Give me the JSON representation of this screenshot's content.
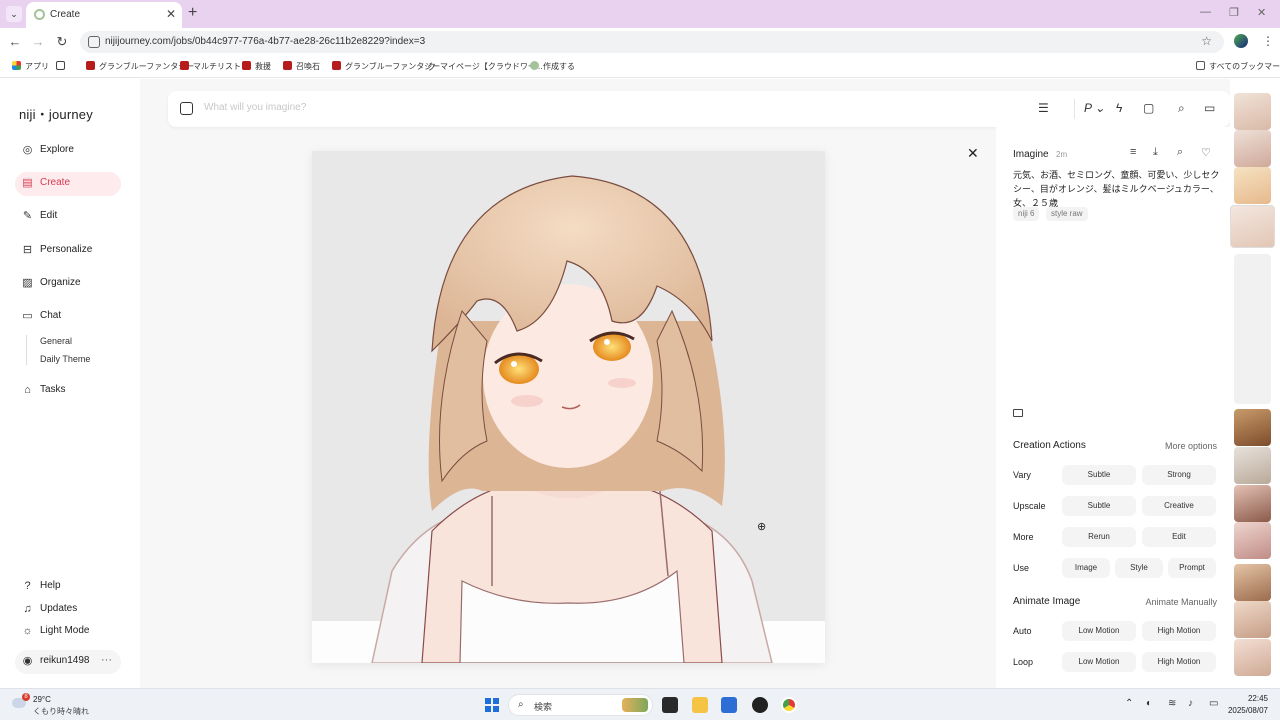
{
  "browser": {
    "tab_title": "Create",
    "url": "nijijourney.com/jobs/0b44c977-776a-4b77-ae28-26c11b2e8229?index=3",
    "bookmarks": [
      "アプリ",
      "グランブルーファンタジー",
      "マルチリスト",
      "救援",
      "召喚石",
      "グランブルーファンタジー",
      "マイページ【クラウドワー...",
      "作成する"
    ],
    "all_bookmarks": "すべてのブックマーク"
  },
  "sidebar": {
    "logo": "niji・journey",
    "items": [
      {
        "label": "Explore",
        "icon": "compass-icon"
      },
      {
        "label": "Create",
        "icon": "brush-icon"
      },
      {
        "label": "Edit",
        "icon": "pencil-icon"
      },
      {
        "label": "Personalize",
        "icon": "personalize-icon"
      },
      {
        "label": "Organize",
        "icon": "image-stack-icon"
      },
      {
        "label": "Chat",
        "icon": "chat-icon"
      }
    ],
    "chat_rooms": [
      "General",
      "Daily Theme"
    ],
    "tasks": "Tasks",
    "bottom": {
      "help": "Help",
      "updates": "Updates",
      "light_mode": "Light Mode",
      "user": "reikun1498"
    }
  },
  "search": {
    "placeholder": "What will you imagine?"
  },
  "panel": {
    "title": "Imagine",
    "time": "2m",
    "prompt": "元気、お酒、セミロング、童顔、可愛い、少しセクシー、目がオレンジ、髪はミルクベージュカラー、女、２５歳",
    "chips": [
      "niji 6",
      "style raw"
    ],
    "creation": {
      "title": "Creation Actions",
      "more": "More options",
      "rows": [
        {
          "label": "Vary",
          "buttons": [
            "Subtle",
            "Strong"
          ]
        },
        {
          "label": "Upscale",
          "buttons": [
            "Subtle",
            "Creative"
          ]
        },
        {
          "label": "More",
          "buttons": [
            "Rerun",
            "Edit"
          ]
        },
        {
          "label": "Use",
          "buttons": [
            "Image",
            "Style",
            "Prompt"
          ]
        }
      ]
    },
    "animate": {
      "title": "Animate Image",
      "more": "Animate Manually",
      "rows": [
        {
          "label": "Auto",
          "buttons": [
            "Low Motion",
            "High Motion"
          ]
        },
        {
          "label": "Loop",
          "buttons": [
            "Low Motion",
            "High Motion"
          ]
        }
      ]
    }
  },
  "taskbar": {
    "weather_badge": "8",
    "temp": "29°C",
    "weather_desc": "くもり時々晴れ",
    "search_text": "検索",
    "time": "22:45",
    "date": "2025/08/07"
  },
  "colors": {
    "accent": "#d63b4e",
    "accent_bg": "#fdebee",
    "hair": "#e6c4a8",
    "eyes": "#f0a431"
  }
}
